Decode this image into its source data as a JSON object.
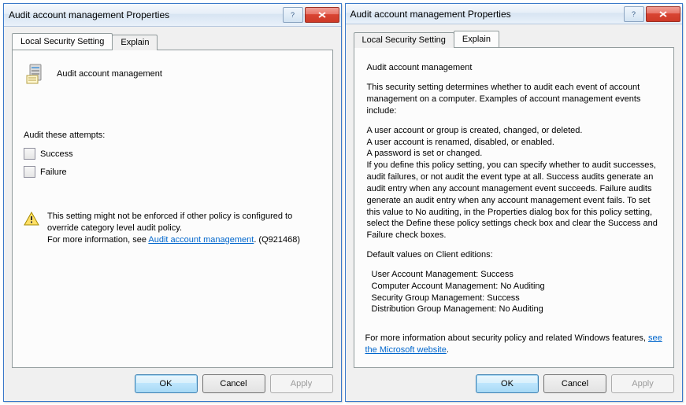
{
  "title": "Audit account management Properties",
  "tabs": {
    "local": "Local Security Setting",
    "explain": "Explain"
  },
  "policy_name": "Audit account management",
  "attempts_label": "Audit these attempts:",
  "checks": {
    "success": "Success",
    "failure": "Failure"
  },
  "warning": {
    "line1": "This setting might not be enforced if other policy is configured to override category level audit policy.",
    "line2_prefix": "For more information, see ",
    "link": "Audit account management",
    "line2_suffix": ". (Q921468)"
  },
  "buttons": {
    "ok": "OK",
    "cancel": "Cancel",
    "apply": "Apply"
  },
  "explain": {
    "heading": "Audit account management",
    "p1": "This security setting determines whether to audit each event of account management on a computer. Examples of account management events include:",
    "l1": "A user account or group is created, changed, or deleted.",
    "l2": "A user account is renamed, disabled, or enabled.",
    "l3": "A password is set or changed.",
    "p2": "If you define this policy setting, you can specify whether to audit successes, audit failures, or not audit the event type at all. Success audits generate an audit entry when any account management event succeeds. Failure audits generate an audit entry when any account management event fails. To set this value to No auditing, in the Properties dialog box for this policy setting, select the Define these policy settings check box and clear the Success and Failure check boxes.",
    "p3": "Default values on Client editions:",
    "d1": "User Account Management: Success",
    "d2": "Computer Account Management: No Auditing",
    "d3": "Security Group Management: Success",
    "d4": "Distribution Group Management: No Auditing",
    "footer_prefix": "For more information about security policy and related Windows features, ",
    "footer_link": "see the Microsoft website",
    "footer_suffix": "."
  }
}
